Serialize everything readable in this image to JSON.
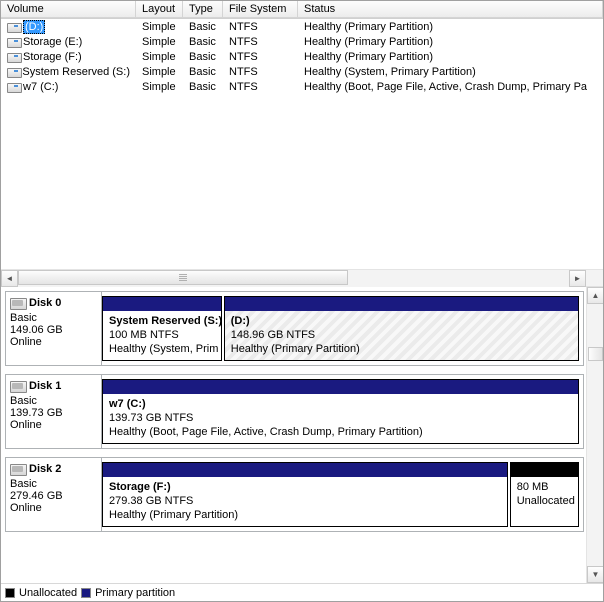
{
  "columns": {
    "volume": "Volume",
    "layout": "Layout",
    "type": "Type",
    "fs": "File System",
    "status": "Status"
  },
  "volumes": [
    {
      "name": "(D:)",
      "layout": "Simple",
      "type": "Basic",
      "fs": "NTFS",
      "status": "Healthy (Primary Partition)",
      "selected": true
    },
    {
      "name": "Storage (E:)",
      "layout": "Simple",
      "type": "Basic",
      "fs": "NTFS",
      "status": "Healthy (Primary Partition)",
      "selected": false
    },
    {
      "name": "Storage (F:)",
      "layout": "Simple",
      "type": "Basic",
      "fs": "NTFS",
      "status": "Healthy (Primary Partition)",
      "selected": false
    },
    {
      "name": "System Reserved (S:)",
      "layout": "Simple",
      "type": "Basic",
      "fs": "NTFS",
      "status": "Healthy (System, Primary Partition)",
      "selected": false
    },
    {
      "name": "w7 (C:)",
      "layout": "Simple",
      "type": "Basic",
      "fs": "NTFS",
      "status": "Healthy (Boot, Page File, Active, Crash Dump, Primary Pa",
      "selected": false
    }
  ],
  "disks": [
    {
      "title": "Disk 0",
      "type": "Basic",
      "size": "149.06 GB",
      "state": "Online",
      "parts": [
        {
          "name": "System Reserved  (S:)",
          "line2": "100 MB NTFS",
          "line3": "Healthy (System, Prim",
          "grow": 1,
          "selected": false,
          "kind": "primary"
        },
        {
          "name": "(D:)",
          "line2": "148.96 GB NTFS",
          "line3": "Healthy (Primary Partition)",
          "grow": 3,
          "selected": true,
          "kind": "primary"
        }
      ]
    },
    {
      "title": "Disk 1",
      "type": "Basic",
      "size": "139.73 GB",
      "state": "Online",
      "parts": [
        {
          "name": "w7  (C:)",
          "line2": "139.73 GB NTFS",
          "line3": "Healthy (Boot, Page File, Active, Crash Dump, Primary Partition)",
          "grow": 1,
          "selected": false,
          "kind": "primary"
        }
      ]
    },
    {
      "title": "Disk 2",
      "type": "Basic",
      "size": "279.46 GB",
      "state": "Online",
      "parts": [
        {
          "name": "Storage  (F:)",
          "line2": "279.38 GB NTFS",
          "line3": "Healthy (Primary Partition)",
          "grow": 6,
          "selected": false,
          "kind": "primary"
        },
        {
          "name": "",
          "line2": "80 MB",
          "line3": "Unallocated",
          "grow": 1,
          "selected": false,
          "kind": "unalloc"
        }
      ]
    }
  ],
  "legend": {
    "unallocated": "Unallocated",
    "primary": "Primary partition"
  }
}
